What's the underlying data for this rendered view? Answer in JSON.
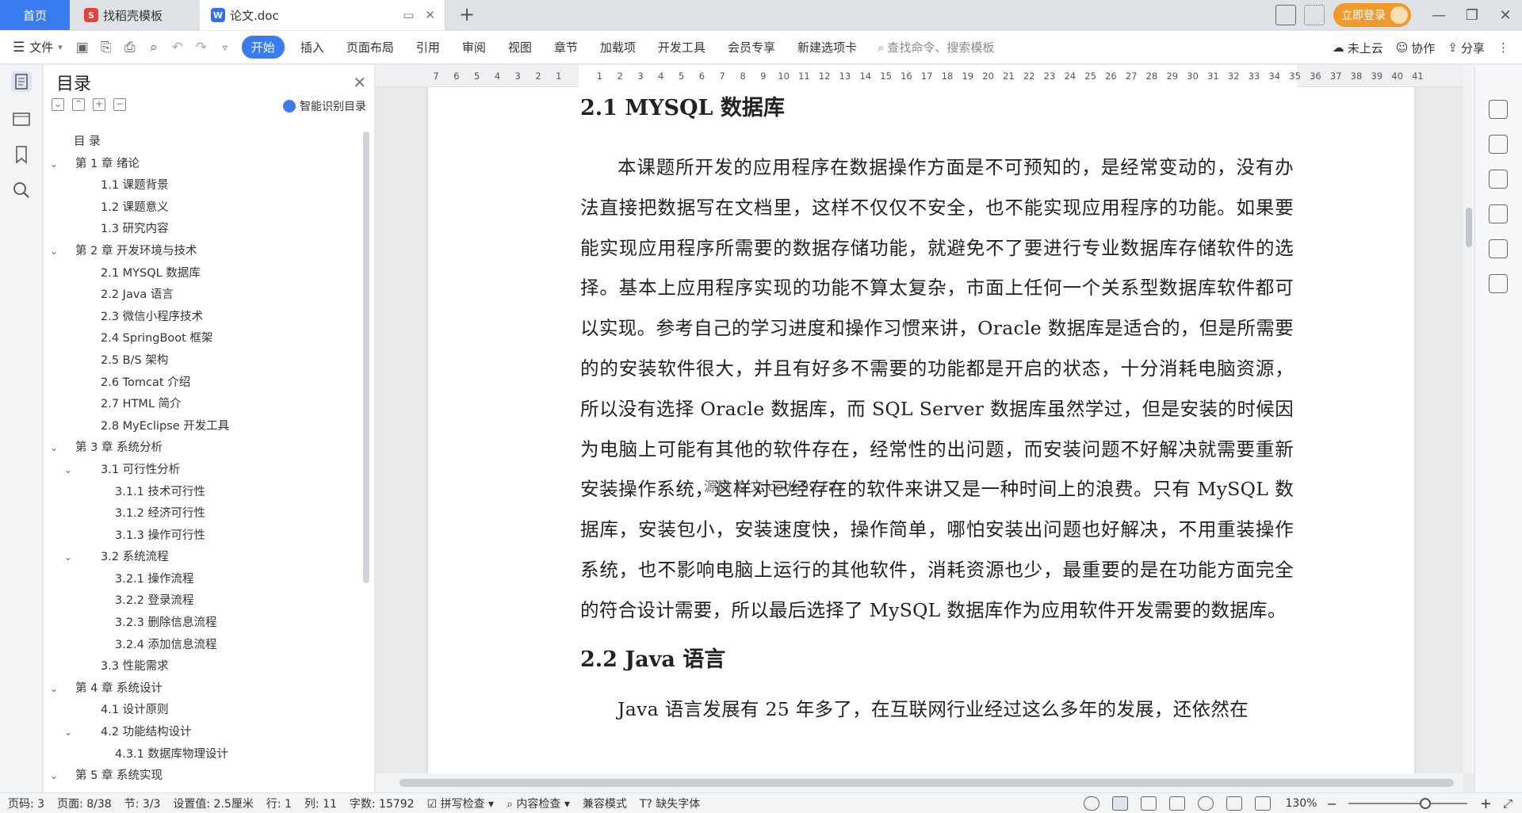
{
  "tabs": {
    "home": "首页",
    "template": "找稻壳模板",
    "doc": "论文.doc"
  },
  "titlebar": {
    "login": "立即登录"
  },
  "ribbon": {
    "file": "文件",
    "items": [
      "开始",
      "插入",
      "页面布局",
      "引用",
      "审阅",
      "视图",
      "章节",
      "加载项",
      "开发工具",
      "会员专享",
      "新建选项卡"
    ],
    "search_placeholder": "查找命令、搜索模板",
    "cloud": "未上云",
    "collab": "协作",
    "share": "分享"
  },
  "toc": {
    "title": "目录",
    "smart": "智能识别目录",
    "items": [
      {
        "text": "目  录",
        "level": 0,
        "caret": ""
      },
      {
        "text": "第 1 章  绪论",
        "level": 0,
        "caret": "v"
      },
      {
        "text": "1.1  课题背景",
        "level": 1,
        "caret": ""
      },
      {
        "text": "1.2  课题意义",
        "level": 1,
        "caret": ""
      },
      {
        "text": "1.3  研究内容",
        "level": 1,
        "caret": ""
      },
      {
        "text": "第 2 章  开发环境与技术",
        "level": 0,
        "caret": "v"
      },
      {
        "text": "2.1 MYSQL 数据库",
        "level": 1,
        "caret": ""
      },
      {
        "text": "2.2 Java 语言",
        "level": 1,
        "caret": ""
      },
      {
        "text": "2.3  微信小程序技术",
        "level": 1,
        "caret": ""
      },
      {
        "text": "2.4 SpringBoot 框架",
        "level": 1,
        "caret": ""
      },
      {
        "text": "2.5 B/S 架构",
        "level": 1,
        "caret": ""
      },
      {
        "text": "2.6 Tomcat  介绍",
        "level": 1,
        "caret": ""
      },
      {
        "text": "2.7 HTML 简介",
        "level": 1,
        "caret": ""
      },
      {
        "text": "2.8 MyEclipse 开发工具",
        "level": 1,
        "caret": ""
      },
      {
        "text": "第 3 章  系统分析",
        "level": 0,
        "caret": "v"
      },
      {
        "text": "3.1  可行性分析",
        "level": 1,
        "caret": "v"
      },
      {
        "text": "3.1.1  技术可行性",
        "level": 2,
        "caret": ""
      },
      {
        "text": "3.1.2  经济可行性",
        "level": 2,
        "caret": ""
      },
      {
        "text": "3.1.3  操作可行性",
        "level": 2,
        "caret": ""
      },
      {
        "text": "3.2  系统流程",
        "level": 1,
        "caret": "v"
      },
      {
        "text": "3.2.1  操作流程",
        "level": 2,
        "caret": ""
      },
      {
        "text": "3.2.2  登录流程",
        "level": 2,
        "caret": ""
      },
      {
        "text": "3.2.3  删除信息流程",
        "level": 2,
        "caret": ""
      },
      {
        "text": "3.2.4  添加信息流程",
        "level": 2,
        "caret": ""
      },
      {
        "text": "3.3  性能需求",
        "level": 1,
        "caret": ""
      },
      {
        "text": "第 4 章  系统设计",
        "level": 0,
        "caret": "v"
      },
      {
        "text": "4.1  设计原则",
        "level": 1,
        "caret": ""
      },
      {
        "text": "4.2  功能结构设计",
        "level": 1,
        "caret": "v"
      },
      {
        "text": "4.3.1  数据库物理设计",
        "level": 2,
        "caret": ""
      },
      {
        "text": "第 5 章  系统实现",
        "level": 0,
        "caret": "v"
      }
    ]
  },
  "ruler": {
    "ticks": [
      "7",
      "6",
      "5",
      "4",
      "3",
      "2",
      "1",
      "",
      "1",
      "2",
      "3",
      "4",
      "5",
      "6",
      "7",
      "8",
      "9",
      "10",
      "11",
      "12",
      "13",
      "14",
      "15",
      "16",
      "17",
      "18",
      "19",
      "20",
      "21",
      "22",
      "23",
      "24",
      "25",
      "26",
      "27",
      "28",
      "29",
      "30",
      "31",
      "32",
      "33",
      "34",
      "35",
      "36",
      "37",
      "38",
      "39",
      "40",
      "41"
    ]
  },
  "document": {
    "heading1": "2.1 MYSQL 数据库",
    "para1": "本课题所开发的应用程序在数据操作方面是不可预知的，是经常变动的，没有办法直接把数据写在文档里，这样不仅仅不安全，也不能实现应用程序的功能。如果要能实现应用程序所需要的数据存储功能，就避免不了要进行专业数据库存储软件的选择。基本上应用程序实现的功能不算太复杂，市面上任何一个关系型数据库软件都可以实现。参考自己的学习进度和操作习惯来讲，Oracle 数据库是适合的，但是所需要的的安装软件很大，并且有好多不需要的功能都是开启的状态，十分消耗电脑资源，所以没有选择 Oracle 数据库，而 SQL Server 数据库虽然学过，但是安装的时候因为电脑上可能有其他的软件存在，经常性的出问题，而安装问题不好解决就需要重新安装操作系统，这样对已经存在的软件来讲又是一种时间上的浪费。只有 MySQL 数据库，安装包小，安装速度快，操作简单，哪怕安装出问题也好解决，不用重装操作系统，也不影响电脑上运行的其他软件，消耗资源也少，最重要的是在功能方面完全的符合设计需要，所以最后选择了 MySQL 数据库作为应用软件开发需要的数据库。",
    "heading2": "2.2 Java 语言",
    "para2": "Java 语言发展有 25 年多了，在互联网行业经过这么多年的发展，还依然在",
    "watermark": "源码 & 文 code99.Fax"
  },
  "status": {
    "page_code": "页码: 3",
    "page": "页面: 8/38",
    "section": "节: 3/3",
    "setting": "设置值: 2.5厘米",
    "row": "行: 1",
    "col": "列: 11",
    "words": "字数: 15792",
    "spell": "拼写检查",
    "content_check": "内容检查",
    "compat": "兼容模式",
    "missing_font": "缺失字体",
    "zoom": "130%"
  }
}
